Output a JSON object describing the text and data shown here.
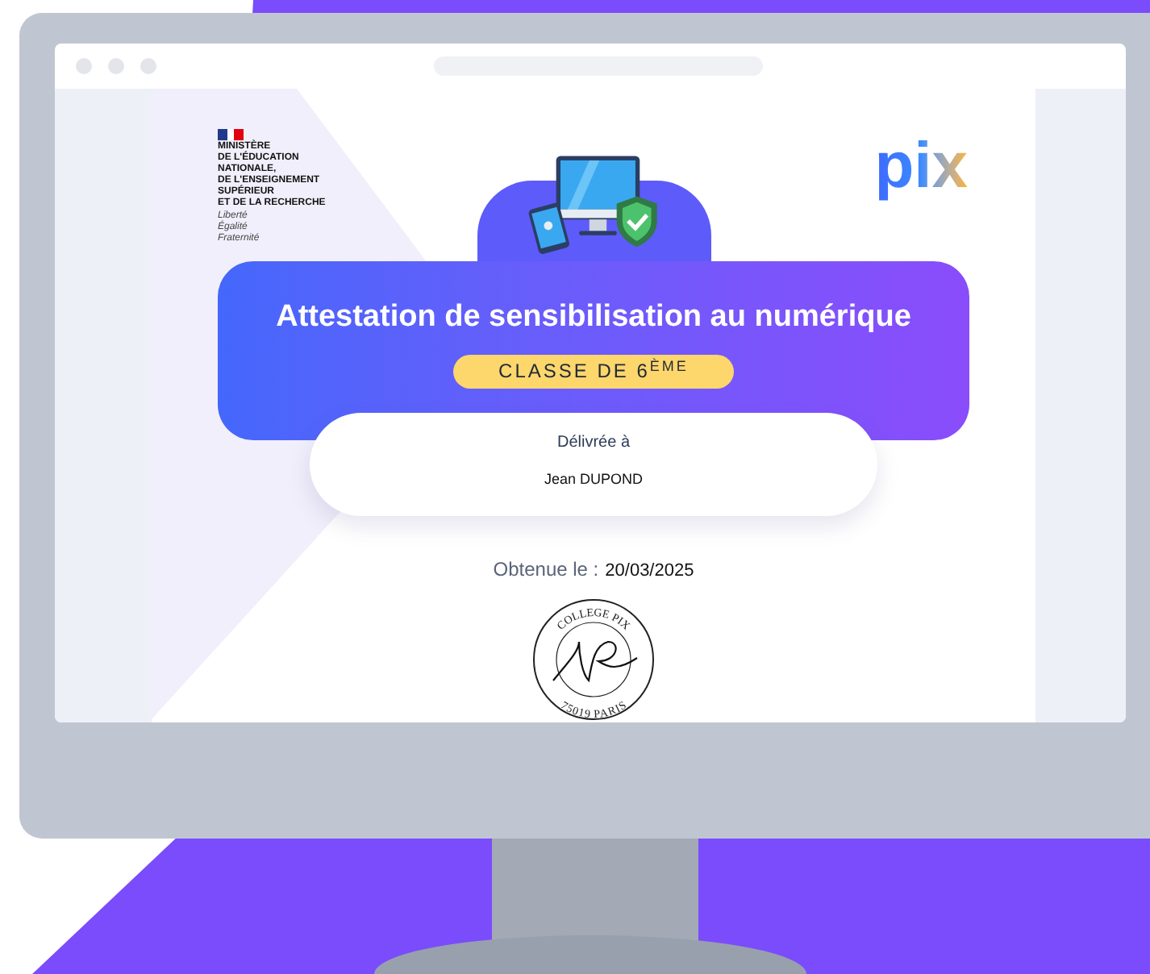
{
  "ministry": {
    "lines": [
      "MINISTÈRE",
      "DE L'ÉDUCATION",
      "NATIONALE,",
      "DE L'ENSEIGNEMENT",
      "SUPÉRIEUR",
      "ET DE LA RECHERCHE"
    ],
    "motto": [
      "Liberté",
      "Égalité",
      "Fraternité"
    ]
  },
  "brand": {
    "logo": "pix"
  },
  "certificate": {
    "title": "Attestation de sensibilisation au numérique",
    "level_badge": "CLASSE DE 6$^{ÈME}$",
    "delivered_label": "Délivrée à",
    "recipient": "Jean DUPOND",
    "obtained_label": "Obtenue le :",
    "date": "20/03/2025"
  },
  "stamp": {
    "top_text": "COLLEGE PIX",
    "bottom_text": "75019 PARIS"
  }
}
